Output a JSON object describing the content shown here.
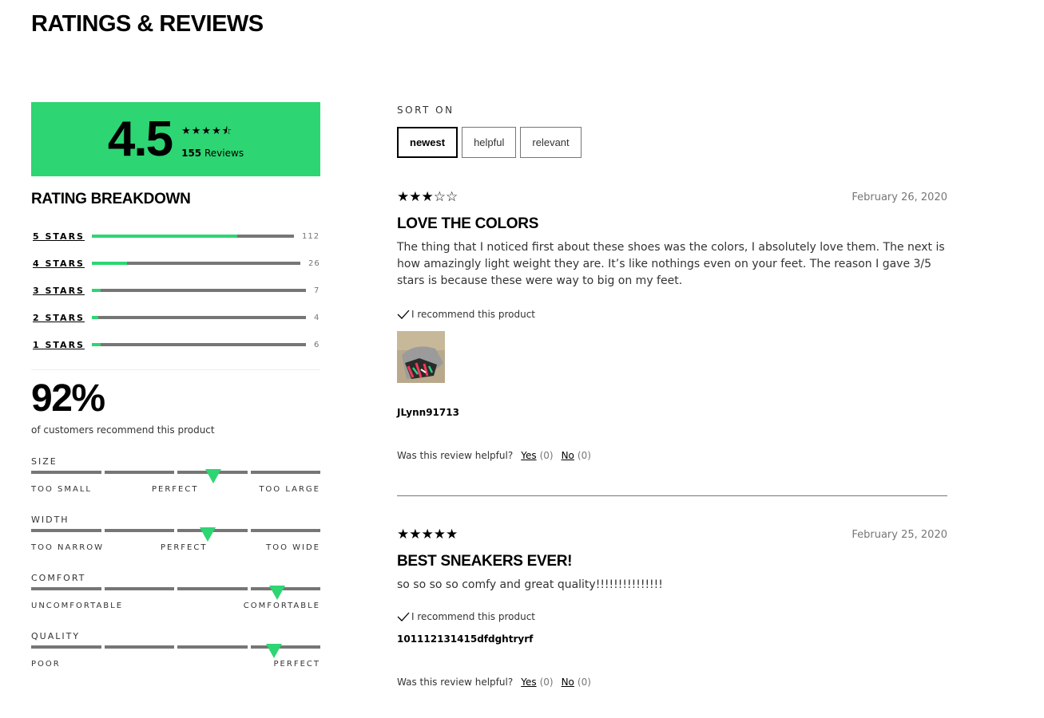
{
  "page": {
    "title": "RATINGS & REVIEWS"
  },
  "summary": {
    "score": "4.5",
    "stars": "★★★★⯪",
    "count": "155",
    "count_label": "Reviews"
  },
  "breakdown": {
    "title": "RATING BREAKDOWN",
    "rows": [
      {
        "label": "5 STARS",
        "count": "112",
        "fraction": 0.72
      },
      {
        "label": "4 STARS",
        "count": "26",
        "fraction": 0.17
      },
      {
        "label": "3 STARS",
        "count": "7",
        "fraction": 0.04
      },
      {
        "label": "2 STARS",
        "count": "4",
        "fraction": 0.03
      },
      {
        "label": "1 STARS",
        "count": "6",
        "fraction": 0.04
      }
    ]
  },
  "recommend": {
    "percent": "92%",
    "label": "of customers recommend this product"
  },
  "fit": [
    {
      "title": "SIZE",
      "position": 0.63,
      "labels": [
        "TOO SMALL",
        "PERFECT",
        "TOO LARGE"
      ]
    },
    {
      "title": "WIDTH",
      "position": 0.61,
      "labels": [
        "TOO NARROW",
        "PERFECT",
        "TOO WIDE"
      ]
    },
    {
      "title": "COMFORT",
      "position": 0.85,
      "labels": [
        "UNCOMFORTABLE",
        "COMFORTABLE"
      ]
    },
    {
      "title": "QUALITY",
      "position": 0.84,
      "labels": [
        "POOR",
        "PERFECT"
      ]
    }
  ],
  "sort": {
    "title": "SORT ON",
    "options": [
      "newest",
      "helpful",
      "relevant"
    ],
    "selected": "newest"
  },
  "reviews": [
    {
      "stars": "★★★☆☆",
      "rating": 3,
      "date": "February 26, 2020",
      "title": "LOVE THE COLORS",
      "body": "The thing that I noticed first about these shoes was the colors, I absolutely love them. The next is how amazingly light weight they are. It’s like nothings even on your feet. The reason I gave 3/5 stars is because these were way to big on my feet.",
      "recommend": "I recommend this product",
      "user": "JLynn91713",
      "helpful_q": "Was this review helpful?",
      "yes": "Yes",
      "yes_count": "(0)",
      "no": "No",
      "no_count": "(0)"
    },
    {
      "stars": "★★★★★",
      "rating": 5,
      "date": "February 25, 2020",
      "title": "BEST SNEAKERS EVER!",
      "body": "so so so so comfy and great quality!!!!!!!!!!!!!!!",
      "recommend": "I recommend this product",
      "user": "101112131415dfdghtryrf",
      "helpful_q": "Was this review helpful?",
      "yes": "Yes",
      "yes_count": "(0)",
      "no": "No",
      "no_count": "(0)"
    }
  ],
  "colors": {
    "accent": "#2ed573",
    "track": "#767677"
  }
}
